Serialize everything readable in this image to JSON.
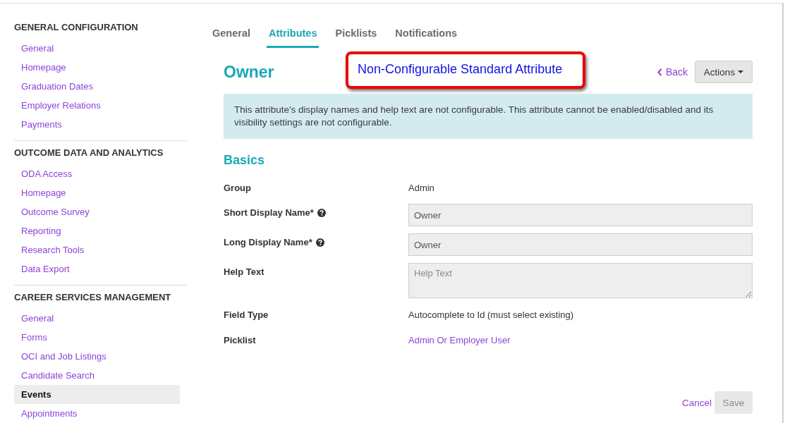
{
  "sidebar": {
    "sections": [
      {
        "heading": "GENERAL CONFIGURATION",
        "items": [
          {
            "label": "General",
            "selected": false
          },
          {
            "label": "Homepage",
            "selected": false
          },
          {
            "label": "Graduation Dates",
            "selected": false
          },
          {
            "label": "Employer Relations",
            "selected": false
          },
          {
            "label": "Payments",
            "selected": false
          }
        ]
      },
      {
        "heading": "OUTCOME DATA AND ANALYTICS",
        "items": [
          {
            "label": "ODA Access",
            "selected": false
          },
          {
            "label": "Homepage",
            "selected": false
          },
          {
            "label": "Outcome Survey",
            "selected": false
          },
          {
            "label": "Reporting",
            "selected": false
          },
          {
            "label": "Research Tools",
            "selected": false
          },
          {
            "label": "Data Export",
            "selected": false
          }
        ]
      },
      {
        "heading": "CAREER SERVICES MANAGEMENT",
        "items": [
          {
            "label": "General",
            "selected": false
          },
          {
            "label": "Forms",
            "selected": false
          },
          {
            "label": "OCI and Job Listings",
            "selected": false
          },
          {
            "label": "Candidate Search",
            "selected": false
          },
          {
            "label": "Events",
            "selected": true
          },
          {
            "label": "Appointments",
            "selected": false
          }
        ]
      }
    ]
  },
  "tabs": [
    {
      "label": "General",
      "selected": false
    },
    {
      "label": "Attributes",
      "selected": true
    },
    {
      "label": "Picklists",
      "selected": false
    },
    {
      "label": "Notifications",
      "selected": false
    }
  ],
  "header": {
    "title": "Owner",
    "callout": "Non-Configurable Standard Attribute",
    "back": "Back",
    "actions": "Actions"
  },
  "notice": "This attribute's display names and help text are not configurable. This attribute cannot be enabled/disabled and its visibility settings are not configurable.",
  "section_title": "Basics",
  "fields": [
    {
      "kind": "text",
      "label": "Group",
      "help": false,
      "value": "Admin"
    },
    {
      "kind": "input",
      "label": "Short Display Name*",
      "help": true,
      "value": "Owner",
      "disabled": true
    },
    {
      "kind": "input",
      "label": "Long Display Name*",
      "help": true,
      "value": "Owner",
      "disabled": true
    },
    {
      "kind": "textarea",
      "label": "Help Text",
      "help": false,
      "placeholder": "Help Text",
      "disabled": true
    },
    {
      "kind": "text",
      "label": "Field Type",
      "help": false,
      "value": "Autocomplete to Id (must select existing)"
    },
    {
      "kind": "link",
      "label": "Picklist",
      "help": false,
      "value": "Admin Or Employer User"
    }
  ],
  "footer": {
    "cancel": "Cancel",
    "save": {
      "label": "Save",
      "disabled": true
    }
  }
}
